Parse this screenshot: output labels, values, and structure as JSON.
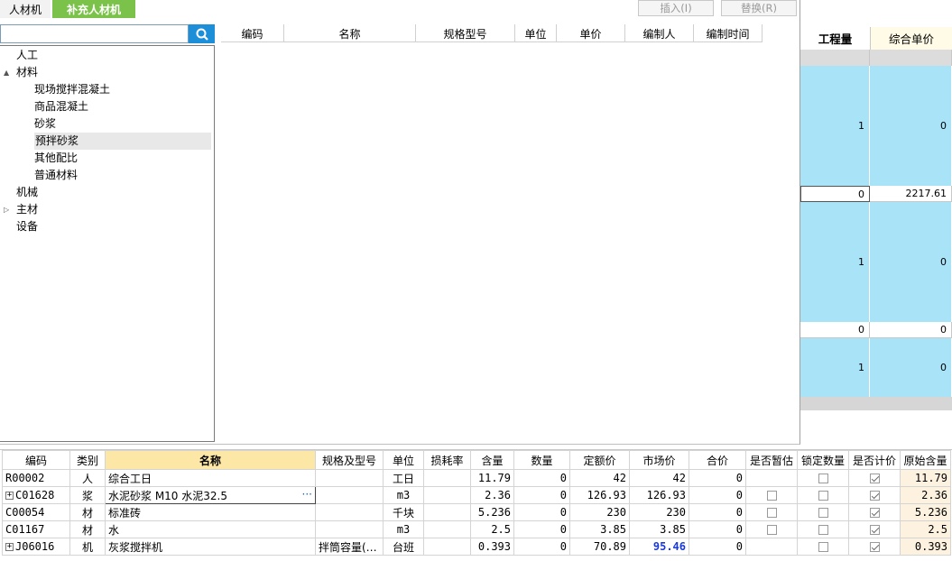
{
  "dialog": {
    "tabs": [
      "人材机",
      "补充人材机"
    ],
    "active_tab": 1,
    "insert_label": "插入(I)",
    "replace_label": "替换(R)",
    "search_placeholder": "",
    "tree": [
      {
        "label": "人工",
        "level": 0,
        "expander": ""
      },
      {
        "label": "材料",
        "level": 0,
        "expander": "▲"
      },
      {
        "label": "现场搅拌混凝土",
        "level": 1,
        "expander": ""
      },
      {
        "label": "商品混凝土",
        "level": 1,
        "expander": ""
      },
      {
        "label": "砂浆",
        "level": 1,
        "expander": ""
      },
      {
        "label": "预拌砂浆",
        "level": 1,
        "expander": "",
        "selected": true
      },
      {
        "label": "其他配比",
        "level": 1,
        "expander": ""
      },
      {
        "label": "普通材料",
        "level": 1,
        "expander": ""
      },
      {
        "label": "机械",
        "level": 0,
        "expander": ""
      },
      {
        "label": "主材",
        "level": 0,
        "expander": "▷"
      },
      {
        "label": "设备",
        "level": 0,
        "expander": ""
      }
    ],
    "list_columns": [
      "编码",
      "名称",
      "规格型号",
      "单位",
      "单价",
      "编制人",
      "编制时间"
    ]
  },
  "background": {
    "col1_header": "工程量",
    "col2_header": "综合单价",
    "rows": [
      {
        "type": "cyan",
        "c1": "1",
        "c2": "0"
      },
      {
        "type": "white",
        "c1": "0",
        "c2": "2217.61"
      },
      {
        "type": "cyan",
        "c1": "1",
        "c2": "0"
      },
      {
        "type": "white",
        "c1": "0",
        "c2": "0"
      },
      {
        "type": "cyan",
        "c1": "1",
        "c2": "0"
      }
    ]
  },
  "bottom_table": {
    "columns": [
      "编码",
      "类别",
      "名称",
      "规格及型号",
      "单位",
      "损耗率",
      "含量",
      "数量",
      "定额价",
      "市场价",
      "合价",
      "是否暂估",
      "锁定数量",
      "是否计价",
      "原始含量"
    ],
    "rows": [
      {
        "code": "R00002",
        "expand": false,
        "type": "人",
        "name": "综合工日",
        "spec": "",
        "unit": "工日",
        "loss": "",
        "content": "11.79",
        "qty": "0",
        "quota": "42",
        "market": "42",
        "market_hl": false,
        "total": "0",
        "est": null,
        "lock": false,
        "priced": true,
        "orig": "11.79"
      },
      {
        "code": "C01628",
        "expand": true,
        "type": "浆",
        "name": "水泥砂浆 M10 水泥32.5",
        "spec": "",
        "unit": "m3",
        "loss": "",
        "content": "2.36",
        "qty": "0",
        "quota": "126.93",
        "market": "126.93",
        "market_hl": false,
        "total": "0",
        "est": false,
        "lock": false,
        "priced": true,
        "orig": "2.36",
        "editing": true
      },
      {
        "code": "C00054",
        "expand": false,
        "type": "材",
        "name": "标准砖",
        "spec": "",
        "unit": "千块",
        "loss": "",
        "content": "5.236",
        "qty": "0",
        "quota": "230",
        "market": "230",
        "market_hl": false,
        "total": "0",
        "est": false,
        "lock": false,
        "priced": true,
        "orig": "5.236"
      },
      {
        "code": "C01167",
        "expand": false,
        "type": "材",
        "name": "水",
        "spec": "",
        "unit": "m3",
        "loss": "",
        "content": "2.5",
        "qty": "0",
        "quota": "3.85",
        "market": "3.85",
        "market_hl": false,
        "total": "0",
        "est": false,
        "lock": false,
        "priced": true,
        "orig": "2.5"
      },
      {
        "code": "J06016",
        "expand": true,
        "type": "机",
        "name": "灰浆搅拌机",
        "spec": "拌筒容量(…",
        "unit": "台班",
        "loss": "",
        "content": "0.393",
        "qty": "0",
        "quota": "70.89",
        "market": "95.46",
        "market_hl": true,
        "total": "0",
        "est": null,
        "lock": false,
        "priced": true,
        "orig": "0.393"
      }
    ]
  },
  "colors": {
    "accent_green": "#7bc24a",
    "search_blue": "#1d8ed8",
    "row_cyan": "#a9e3f7",
    "header_highlight": "#fde7a6"
  }
}
